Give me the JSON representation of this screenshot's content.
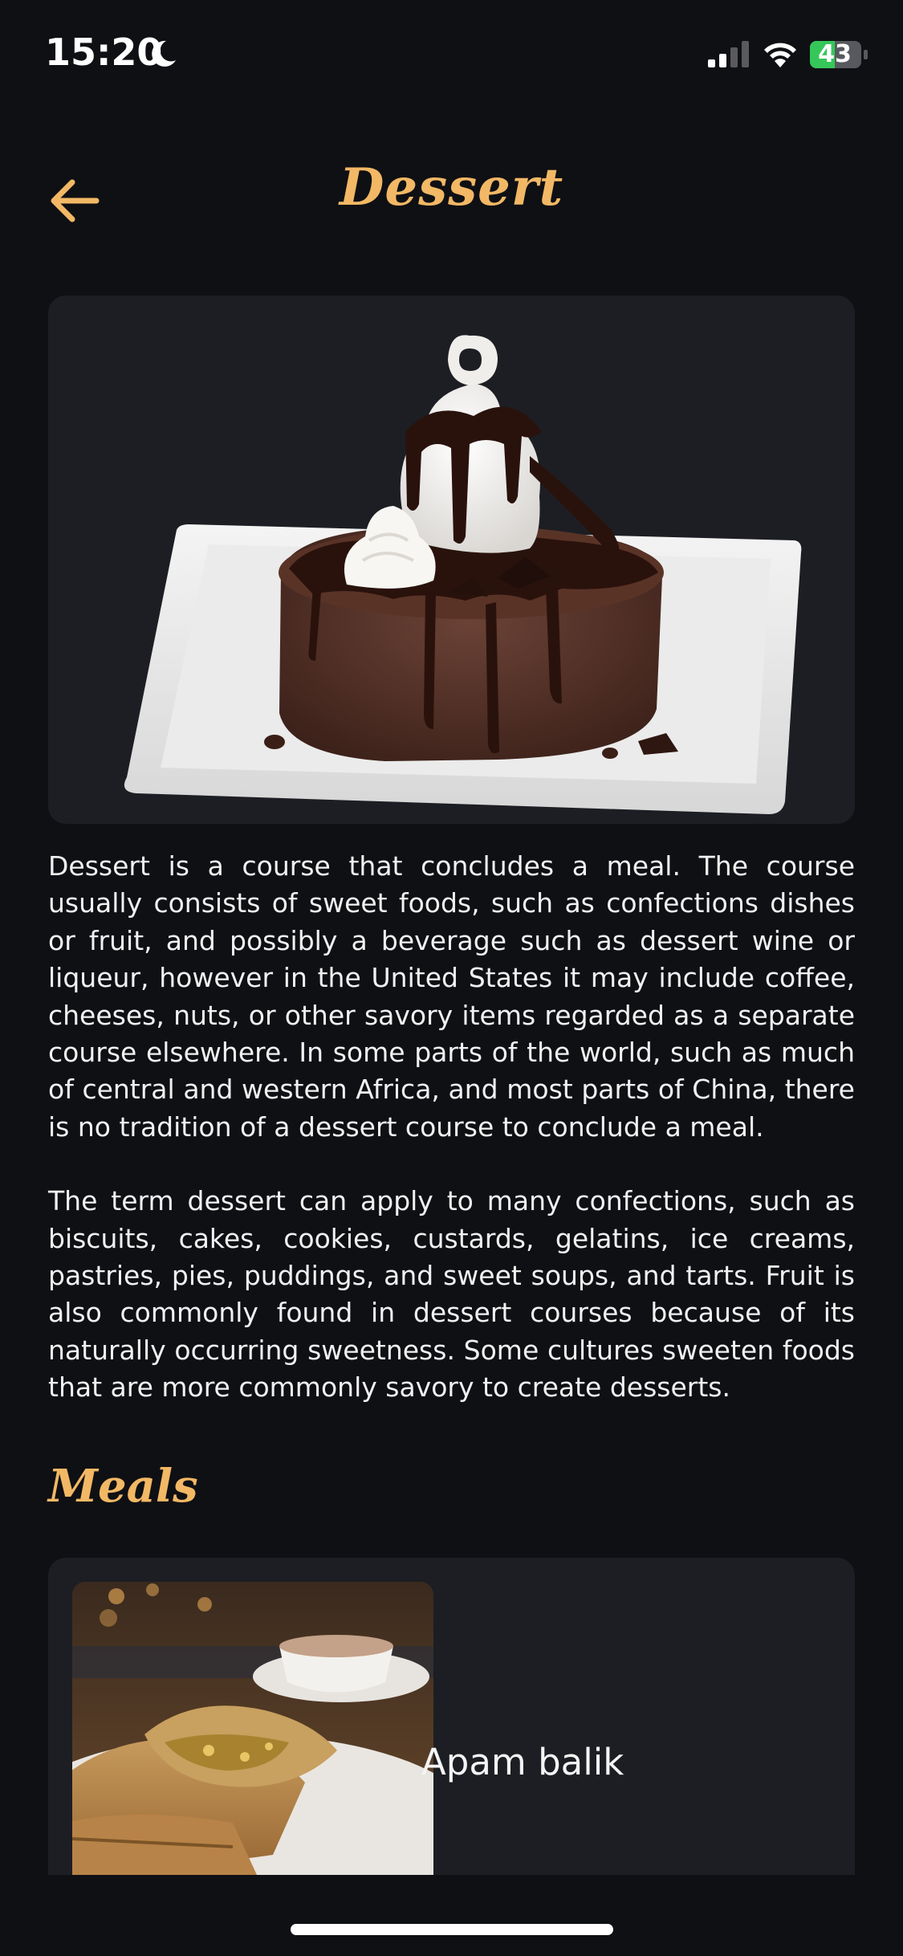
{
  "status_bar": {
    "time": "15:20",
    "battery": "43"
  },
  "header": {
    "title": "Dessert"
  },
  "category": {
    "description_paragraphs": [
      "Dessert is a course that concludes a meal. The course usually consists of sweet foods, such as confections dishes or fruit, and possibly a beverage such as dessert wine or liqueur, however in the United States it may include coffee, cheeses, nuts, or other savory items regarded as a separate course elsewhere. In some parts of the world, such as much of central and western Africa, and most parts of China, there is no tradition of a dessert course to conclude a meal.",
      "The term dessert can apply to many confections, such as biscuits, cakes, cookies, custards, gelatins, ice creams, pastries, pies, puddings, and sweet soups, and tarts. Fruit is also commonly found in dessert courses because of its naturally occurring sweetness. Some cultures sweeten foods that are more commonly savory to create desserts."
    ]
  },
  "meals_section": {
    "title": "Meals",
    "items": [
      {
        "name": "Apam balik"
      }
    ]
  },
  "colors": {
    "background": "#0f1014",
    "card": "#1d1e23",
    "accent": "#f2b865",
    "text": "#f1f1f1"
  },
  "icons": {
    "back": "arrow-left-icon",
    "moon": "moon-icon",
    "signal": "cellular-signal-icon",
    "wifi": "wifi-icon",
    "battery": "battery-charging-icon"
  }
}
